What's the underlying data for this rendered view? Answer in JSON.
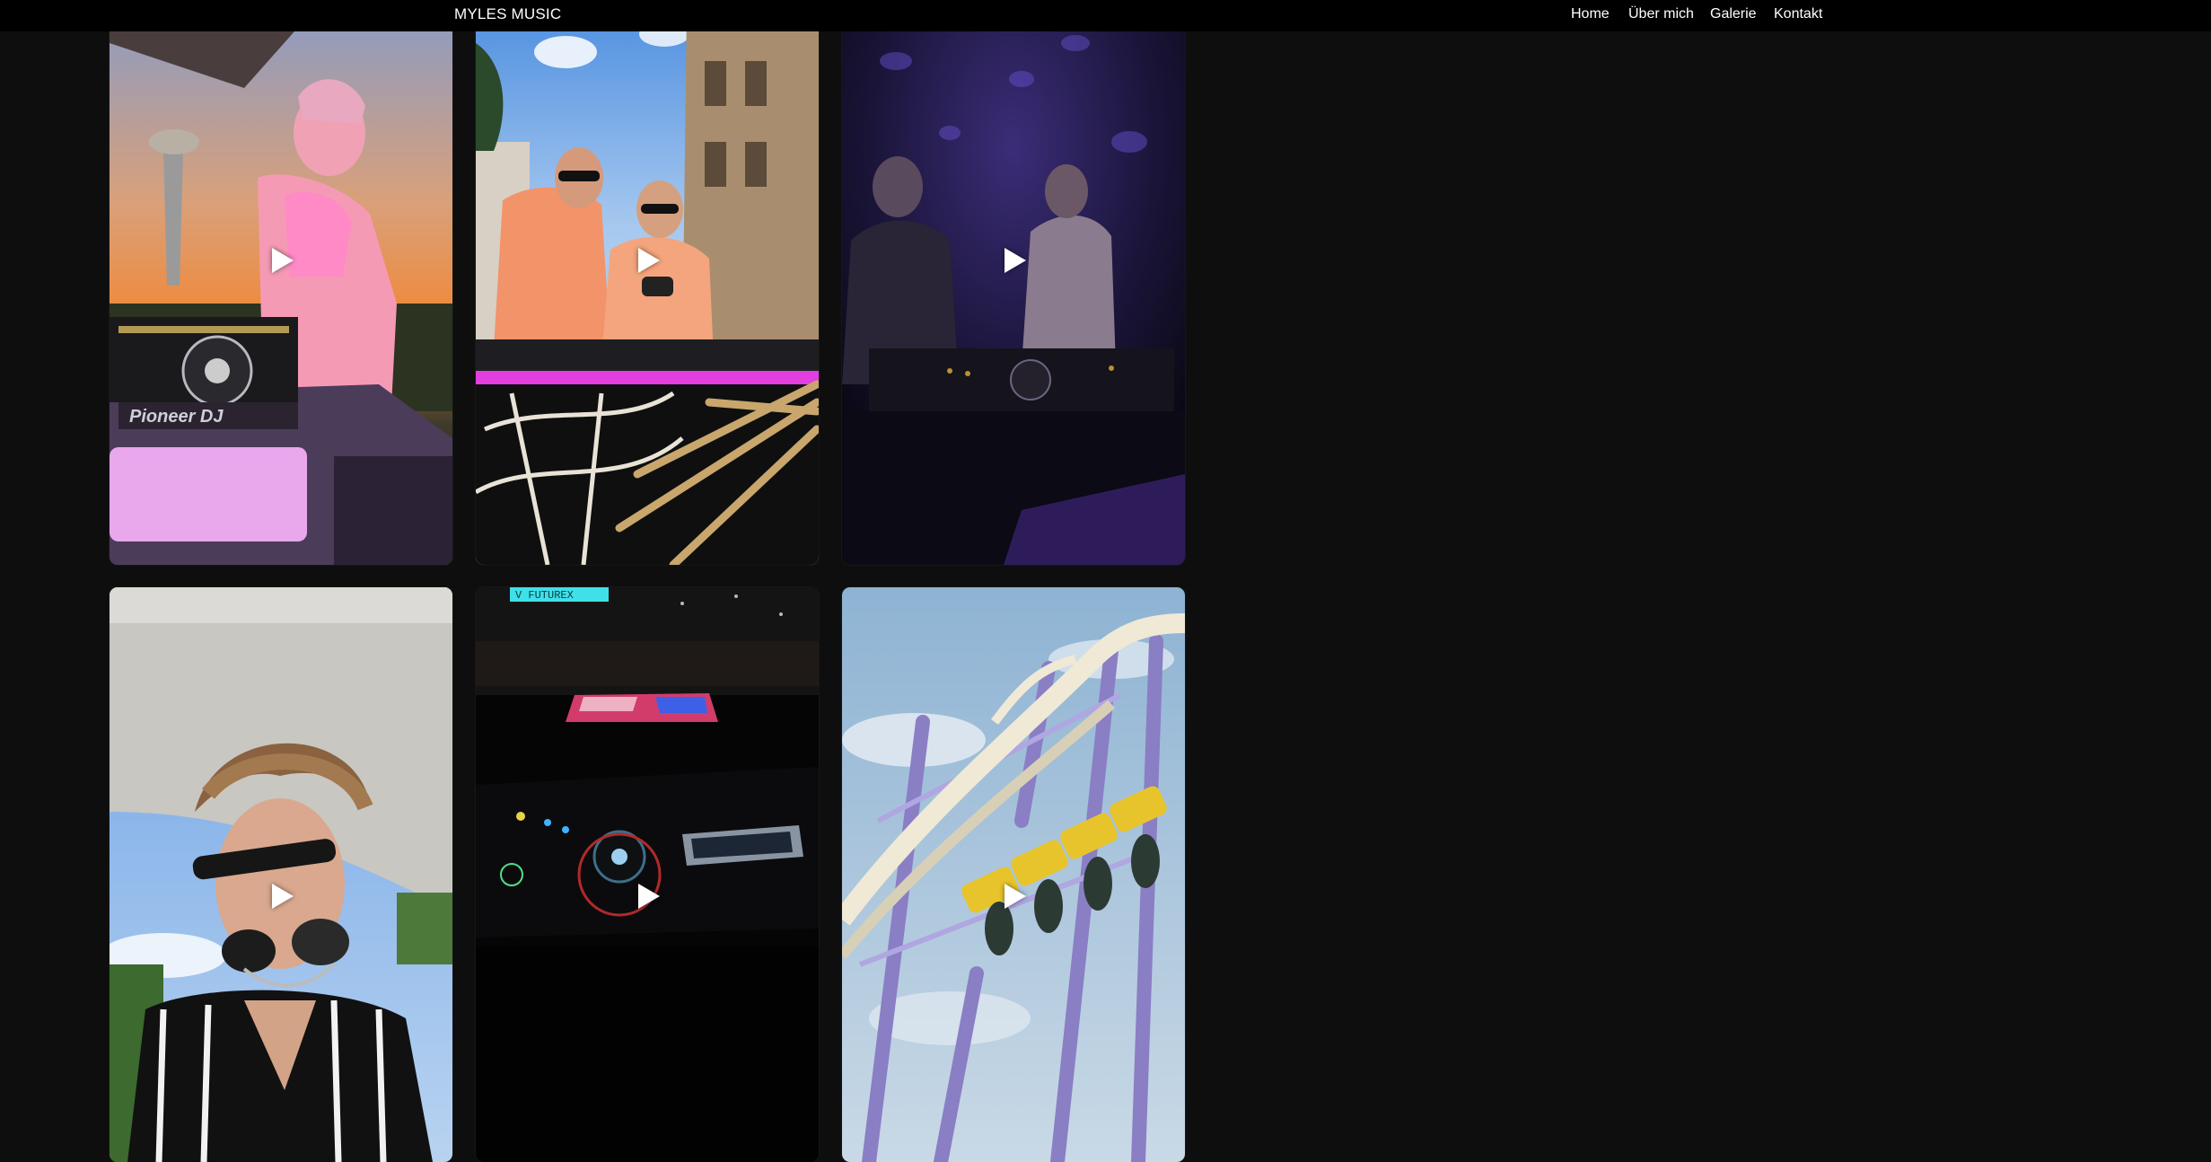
{
  "header": {
    "brand": "MYLES MUSIC",
    "nav": [
      {
        "label": "Home"
      },
      {
        "label": "Über mich"
      },
      {
        "label": "Galerie"
      },
      {
        "label": "Kontakt"
      }
    ]
  },
  "gallery": {
    "videos": [
      {
        "scene": "dj-sunset-terrace",
        "icon": "play-icon"
      },
      {
        "scene": "two-djs-sunglasses",
        "icon": "play-icon"
      },
      {
        "scene": "dj-duo-night-purple",
        "icon": "play-icon"
      },
      {
        "scene": "dj-portrait-umbrella",
        "icon": "play-icon"
      },
      {
        "scene": "dj-booth-dark",
        "icon": "play-icon"
      },
      {
        "scene": "rollercoaster",
        "icon": "play-icon"
      }
    ]
  },
  "colors": {
    "background": "#0e0e0e",
    "navbar": "#000000",
    "text": "#ffffff"
  }
}
